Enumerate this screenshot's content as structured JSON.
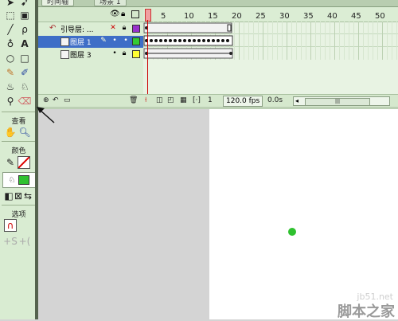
{
  "top_tabs": {
    "timeline_tab": "时间轴",
    "scene_label": "场景 1"
  },
  "layers": {
    "header_icons": [
      "eye-icon",
      "lock-icon",
      "outline-icon"
    ],
    "rows": [
      {
        "name": "引导层: ...",
        "state_icon": "✕",
        "swatch_color": "#9933cc",
        "selected": false
      },
      {
        "name": "图层 1",
        "state_icon": "•",
        "swatch_color": "#33cc33",
        "selected": true
      },
      {
        "name": "图层 3",
        "state_icon": "•",
        "swatch_color": "#ffff33",
        "selected": false
      }
    ]
  },
  "ruler": {
    "ticks": [
      "5",
      "10",
      "15",
      "20",
      "25",
      "30",
      "35",
      "40",
      "45",
      "50"
    ]
  },
  "timeline_bottom": {
    "current_frame": "1",
    "fps": "120.0 fps",
    "time": "0.0s"
  },
  "toolbox": {
    "view_label": "查看",
    "colors_label": "颜色",
    "options_label": "选项"
  },
  "watermark": {
    "site": "jb51.net",
    "logo": "脚本之家"
  },
  "colors": {
    "stage_dot": "#2fc12f",
    "panel_green": "#d9ecd2",
    "playhead_red": "#cc0000"
  }
}
